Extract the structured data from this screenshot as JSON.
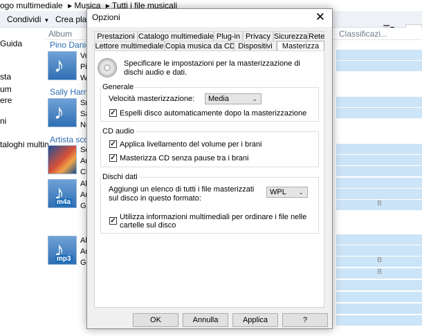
{
  "background": {
    "breadcrumb": [
      "ogo multimediale",
      "▸ Musica",
      "▸ Tutti i file musicali"
    ],
    "toolbar": {
      "share": "Condividi",
      "create": "Crea playl"
    },
    "sidebar": [
      "Guida",
      "sta",
      "um",
      "ere",
      "ni",
      "taloghi multin"
    ],
    "columns": {
      "album": "Album",
      "classification": "Classificazi..."
    },
    "artists": [
      "Pino Daniel",
      "Sally Harmo",
      "Artista scon"
    ],
    "tracks": [
      "Vo",
      "Pi",
      "W",
      "Sn",
      "Sa",
      "Ne",
      "Se",
      "An",
      "Cl",
      "Al",
      "Ar",
      "Ge",
      "Al",
      "Ar",
      "Ge"
    ],
    "format_badges": [
      "m4a",
      "mp3"
    ],
    "size_suffix": "B"
  },
  "dialog": {
    "title": "Opzioni",
    "close": "✕",
    "tabs_top": [
      "Prestazioni",
      "Catalogo multimediale",
      "Plug-in",
      "Privacy",
      "Sicurezza",
      "Rete"
    ],
    "tabs_bottom": [
      "Lettore multimediale",
      "Copia musica da CD",
      "Dispositivi",
      "Masterizza"
    ],
    "active_tab": "Masterizza",
    "intro": "Specificare le impostazioni per la masterizzazione di dischi audio e dati.",
    "general": {
      "label": "Generale",
      "speed_label": "Velocità masterizzazione:",
      "speed_value": "Media",
      "eject_label": "Espelli disco automaticamente dopo la masterizzazione",
      "eject_checked": true
    },
    "audio_cd": {
      "label": "CD audio",
      "leveling_label": "Applica livellamento del volume per i brani",
      "leveling_checked": true,
      "gapless_label": "Masterizza CD senza pause tra i brani",
      "gapless_checked": true
    },
    "data_discs": {
      "label": "Dischi dati",
      "list_label": "Aggiungi un elenco di tutti i file masterizzati sul disco in questo formato:",
      "list_format": "WPL",
      "media_info_label": "Utilizza informazioni multimediali per ordinare i file nelle cartelle sul disco",
      "media_info_checked": true
    },
    "buttons": {
      "ok": "OK",
      "cancel": "Annulla",
      "apply": "Applica",
      "help": "?"
    },
    "check_glyph": "✓",
    "combo_arrow": "⌄"
  }
}
